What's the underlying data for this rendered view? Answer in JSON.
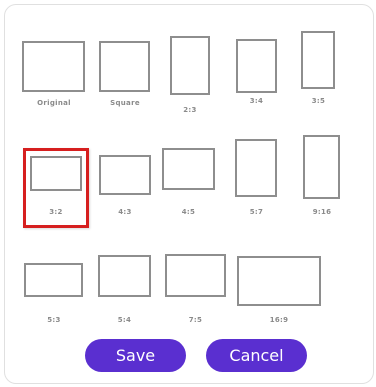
{
  "dialog": {
    "ratios": [
      {
        "id": "original",
        "label": "Original"
      },
      {
        "id": "square",
        "label": "Square"
      },
      {
        "id": "2-3",
        "label": "2:3"
      },
      {
        "id": "3-4",
        "label": "3:4"
      },
      {
        "id": "3-5",
        "label": "3:5"
      },
      {
        "id": "3-2",
        "label": "3:2",
        "selected": true
      },
      {
        "id": "4-3",
        "label": "4:3"
      },
      {
        "id": "4-5",
        "label": "4:5"
      },
      {
        "id": "5-7",
        "label": "5:7"
      },
      {
        "id": "9-16",
        "label": "9:16"
      },
      {
        "id": "5-3",
        "label": "5:3"
      },
      {
        "id": "5-4",
        "label": "5:4"
      },
      {
        "id": "7-5",
        "label": "7:5"
      },
      {
        "id": "16-9",
        "label": "16:9"
      }
    ],
    "selected_label": "3:2",
    "save_label": "Save",
    "cancel_label": "Cancel"
  },
  "colors": {
    "accent": "#5a2fd0",
    "selected_border": "#d61f1f",
    "rect_border": "#8e8e8e",
    "label_text": "#8a8a8a"
  }
}
